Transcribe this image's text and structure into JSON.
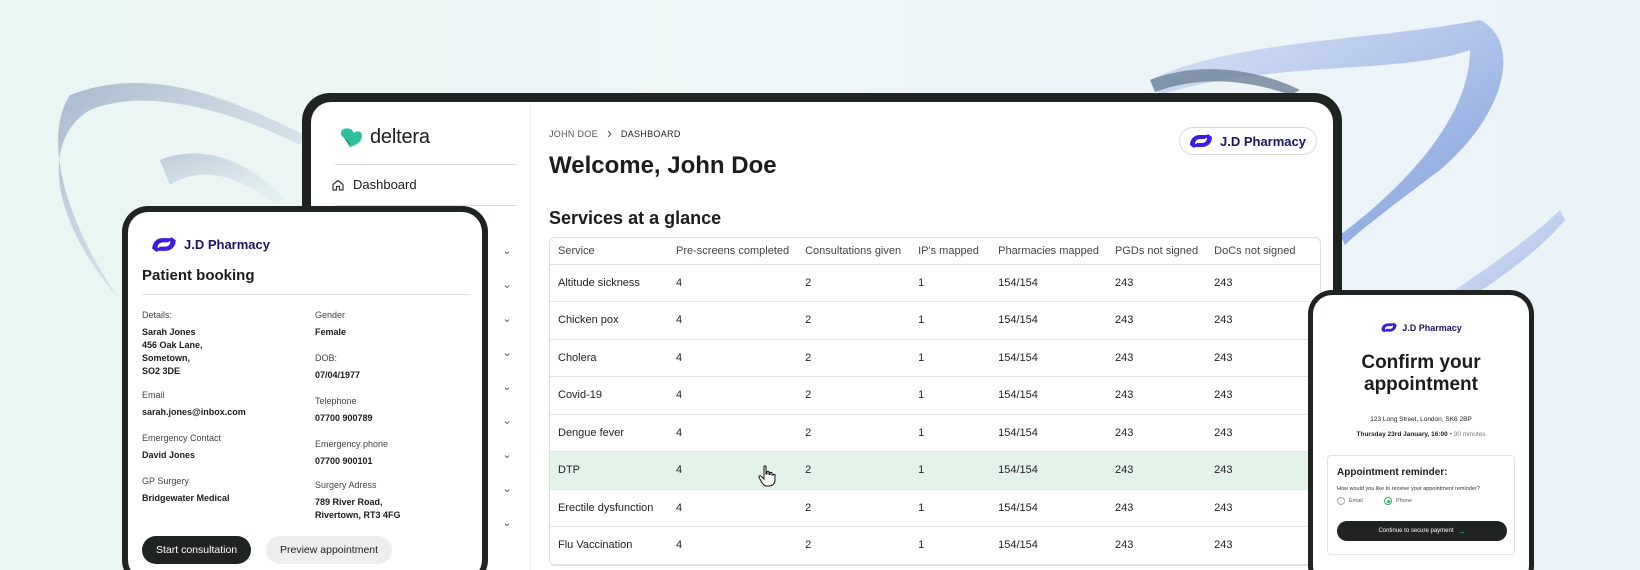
{
  "colors": {
    "accent_green": "#2aa86a",
    "pharmacy_blue": "#3e1de0",
    "dark": "#1f2321",
    "highlight_row": "#e4f3ea"
  },
  "app": {
    "brand": "deltera",
    "nav": {
      "dashboard": "Dashboard",
      "icon": "home-icon"
    },
    "breadcrumb": {
      "root": "JOHN DOE",
      "separator_icon": "chevron-right-icon",
      "current": "DASHBOARD"
    },
    "welcome": "Welcome, John Doe",
    "pharmacy_badge": "J.D Pharmacy",
    "section_title": "Services at a glance",
    "table": {
      "headers": [
        "Service",
        "Pre-screens completed",
        "Consultations given",
        "IP's mapped",
        "Pharmacies mapped",
        "PGDs not signed",
        "DoCs not signed"
      ],
      "rows": [
        [
          "Altitude sickness",
          "4",
          "2",
          "1",
          "154/154",
          "243",
          "243"
        ],
        [
          "Chicken pox",
          "4",
          "2",
          "1",
          "154/154",
          "243",
          "243"
        ],
        [
          "Cholera",
          "4",
          "2",
          "1",
          "154/154",
          "243",
          "243"
        ],
        [
          "Covid-19",
          "4",
          "2",
          "1",
          "154/154",
          "243",
          "243"
        ],
        [
          "Dengue fever",
          "4",
          "2",
          "1",
          "154/154",
          "243",
          "243"
        ],
        [
          "DTP",
          "4",
          "2",
          "1",
          "154/154",
          "243",
          "243"
        ],
        [
          "Erectile dysfunction",
          "4",
          "2",
          "1",
          "154/154",
          "243",
          "243"
        ],
        [
          "Flu Vaccination",
          "4",
          "2",
          "1",
          "154/154",
          "243",
          "243"
        ]
      ],
      "highlighted_row": "DTP"
    }
  },
  "booking": {
    "brand": "J.D Pharmacy",
    "title": "Patient booking",
    "fields": {
      "details_label": "Details:",
      "details_value": "Sarah Jones\n456 Oak Lane,\nSometown,\nSO2 3DE",
      "gender_label": "Gender",
      "gender_value": "Female",
      "dob_label": "DOB:",
      "dob_value": "07/04/1977",
      "email_label": "Email",
      "email_value": "sarah.jones@inbox.com",
      "telephone_label": "Telephone",
      "telephone_value": "07700 900789",
      "emergency_contact_label": "Emergency Contact",
      "emergency_contact_value": "David Jones",
      "emergency_phone_label": "Emergency phone",
      "emergency_phone_value": "07700 900101",
      "gp_label": "GP Surgery",
      "gp_value": "Bridgewater Medical",
      "surgery_address_label": "Surgery Adress",
      "surgery_address_value": "789 River Road,\nRivertown, RT3 4FG"
    },
    "start_button": "Start consultation",
    "preview_button": "Preview appointment"
  },
  "confirm": {
    "brand": "J.D Pharmacy",
    "title": "Confirm your\nappointment",
    "address": "123 Long Street, London, SK6 2BP",
    "datetime": "Thursday 23rd January, 16:00",
    "separator": "•",
    "duration": "30 minutes",
    "reminder_title": "Appointment reminder:",
    "reminder_question": "How would you like to receive your appointment reminder?",
    "option_email": "Email",
    "option_phone": "Phone",
    "selected_option": "Phone",
    "continue_button": "Continue to secure payment",
    "continue_icon": "arrow-right-icon"
  }
}
